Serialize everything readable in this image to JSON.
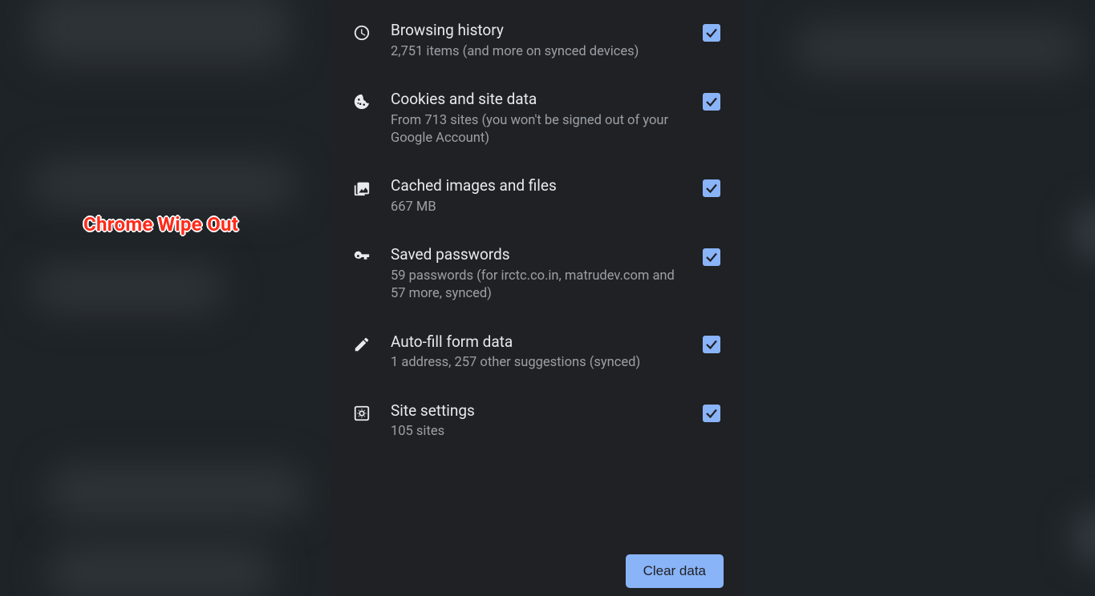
{
  "overlay": {
    "text": "Chrome Wipe Out"
  },
  "panel": {
    "items": [
      {
        "icon": "clock-icon",
        "title": "Browsing history",
        "subtitle": "2,751 items (and more on synced devices)",
        "checked": true
      },
      {
        "icon": "cookie-icon",
        "title": "Cookies and site data",
        "subtitle": "From 713 sites (you won't be signed out of your Google Account)",
        "checked": true
      },
      {
        "icon": "image-icon",
        "title": "Cached images and files",
        "subtitle": "667 MB",
        "checked": true
      },
      {
        "icon": "key-icon",
        "title": "Saved passwords",
        "subtitle": "59 passwords (for irctc.co.in, matrudev.com and 57 more, synced)",
        "checked": true
      },
      {
        "icon": "pencil-icon",
        "title": "Auto-fill form data",
        "subtitle": "1 address, 257 other suggestions (synced)",
        "checked": true
      },
      {
        "icon": "site-settings-icon",
        "title": "Site settings",
        "subtitle": "105 sites",
        "checked": true
      }
    ],
    "clear_button_label": "Clear data"
  }
}
